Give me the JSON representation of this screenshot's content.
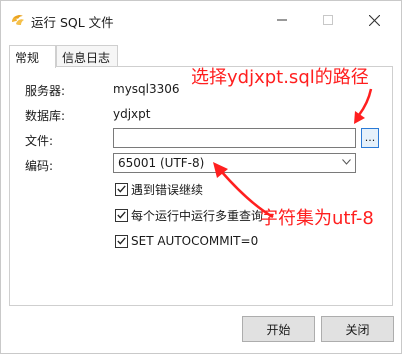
{
  "window": {
    "title": "运行 SQL 文件",
    "controls": {
      "minimize": "minimize-icon",
      "maximize": "maximize-icon",
      "close": "close-icon"
    }
  },
  "tabs": [
    {
      "label": "常规",
      "active": true
    },
    {
      "label": "信息日志",
      "active": false
    }
  ],
  "form": {
    "server_label": "服务器:",
    "server_value": "mysql3306",
    "database_label": "数据库:",
    "database_value": "ydjxpt",
    "file_label": "文件:",
    "file_value": "",
    "browse_label": "...",
    "encoding_label": "编码:",
    "encoding_value": "65001 (UTF-8)"
  },
  "options": [
    {
      "label": "遇到错误继续",
      "checked": true
    },
    {
      "label": "每个运行中运行多重查询",
      "checked": true
    },
    {
      "label": "SET AUTOCOMMIT=0",
      "checked": true
    }
  ],
  "annotations": {
    "select_path": "选择ydjxpt.sql的路径",
    "charset": "字符集为utf-8",
    "color": "#ff1f1f"
  },
  "buttons": {
    "start": "开始",
    "close": "关闭"
  },
  "colors": {
    "accent": "#2a7ad6",
    "annotation": "#ff1f1f"
  }
}
